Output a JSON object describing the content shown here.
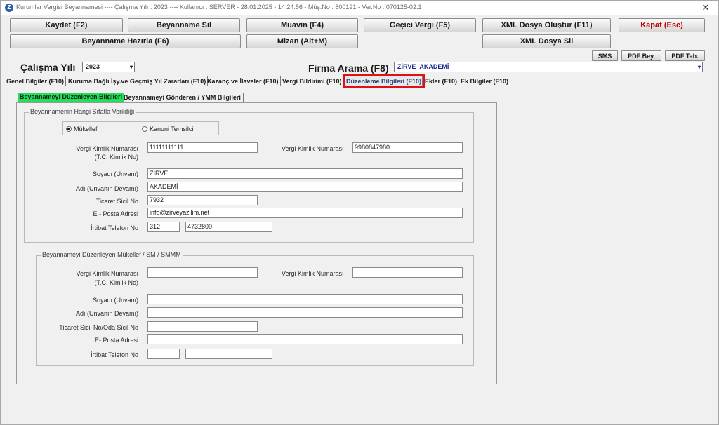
{
  "titlebar": {
    "app_title": "Kurumlar Vergisi Beyannamesi  ----  Çalışma Yılı : 2023  ----  Kullanıcı : SERVER - 28.01.2025 - 14:24:56 - Müş.No : 800191 - Ver.No : 070125-02.1",
    "close_glyph": "✕"
  },
  "toolbar": {
    "kaydet": "Kaydet (F2)",
    "beyanname_sil": "Beyanname Sil",
    "muavin": "Muavin (F4)",
    "gecici_vergi": "Geçici Vergi (F5)",
    "xml_olustur": "XML Dosya Oluştur (F11)",
    "kapat": "Kapat (Esc)",
    "beyanname_hazirla": "Beyanname Hazırla (F6)",
    "mizan": "Mizan (Alt+M)",
    "xml_sil": "XML Dosya Sil",
    "sms": "SMS",
    "pdf_bey": "PDF Bey.",
    "pdf_tah": "PDF Tah."
  },
  "filters": {
    "calisma_yili_label": "Çalışma Yılı",
    "calisma_yili_value": "2023",
    "firma_arama_label": "Firma Arama (F8)",
    "firma_value": "ZİRVE_AKADEMİ",
    "dropdown_arrow": "▾"
  },
  "tabs": [
    {
      "label": "Genel Bilgiler (F10)"
    },
    {
      "label": "Kuruma Bağlı İşy.ve Geçmiş Yıl Zararları (F10)"
    },
    {
      "label": "Kazanç ve İlaveler (F10)"
    },
    {
      "label": "Vergi Bildirimi (F10)"
    },
    {
      "label": "Düzenleme Bilgileri (F10)"
    },
    {
      "label": "Ekler (F10)"
    },
    {
      "label": "Ek Bilgiler (F10)"
    }
  ],
  "subtabs": [
    {
      "label": "Beyannameyi Düzenleyen Bilgileri"
    },
    {
      "label": "Beyannameyi Gönderen / YMM Bilgileri"
    }
  ],
  "group1": {
    "legend": "Beyannamenin Hangi Sıfatla Verildiği",
    "radio_mukellef": "Mükellef",
    "radio_kanuni": "Kanuni Temsilci",
    "vkn_label_1": "Vergi Kimlik Numarası",
    "vkn_label_2": "(T.C. Kimlik No)",
    "vkn_value": "11111111111",
    "vkn2_label": "Vergi Kimlik Numarası",
    "vkn2_value": "9980847980",
    "soyadi_label": "Soyadı (Unvanı)",
    "soyadi_value": "ZİRVE",
    "adi_label": "Adı (Unvanın Devamı)",
    "adi_value": "AKADEMİ",
    "ticaret_label": "Ticaret Sicil No",
    "ticaret_value": "7932",
    "eposta_label": "E - Posta Adresi",
    "eposta_value": "info@zirveyazilim.net",
    "tel_label": "İrtibat Telefon No",
    "tel_area": "312",
    "tel_number": "4732800"
  },
  "group2": {
    "legend": "Beyannameyi Düzenleyen Mükellef / SM / SMMM",
    "vkn_label_1": "Vergi Kimlik Numarası",
    "vkn_label_2": "(T.C. Kimlik No)",
    "vkn_value": "",
    "vkn2_label": "Vergi Kimlik Numarası",
    "vkn2_value": "",
    "soyadi_label": "Soyadı (Unvanı)",
    "soyadi_value": "",
    "adi_label": "Adı (Unvanın Devamı)",
    "adi_value": "",
    "ticaret_label": "Ticaret Sicil No/Oda Sicil No",
    "ticaret_value": "",
    "eposta_label": "E- Posta Adresi",
    "eposta_value": "",
    "tel_label": "İrtibat Telefon No",
    "tel_area": "",
    "tel_number": ""
  },
  "colors": {
    "active_tab_highlight": "#e0101a",
    "active_subtab": "#22e05a",
    "kapat_text": "#c00000"
  },
  "icons": {
    "app": "app-logo-icon",
    "close": "close-icon",
    "dropdown": "chevron-down-icon"
  }
}
